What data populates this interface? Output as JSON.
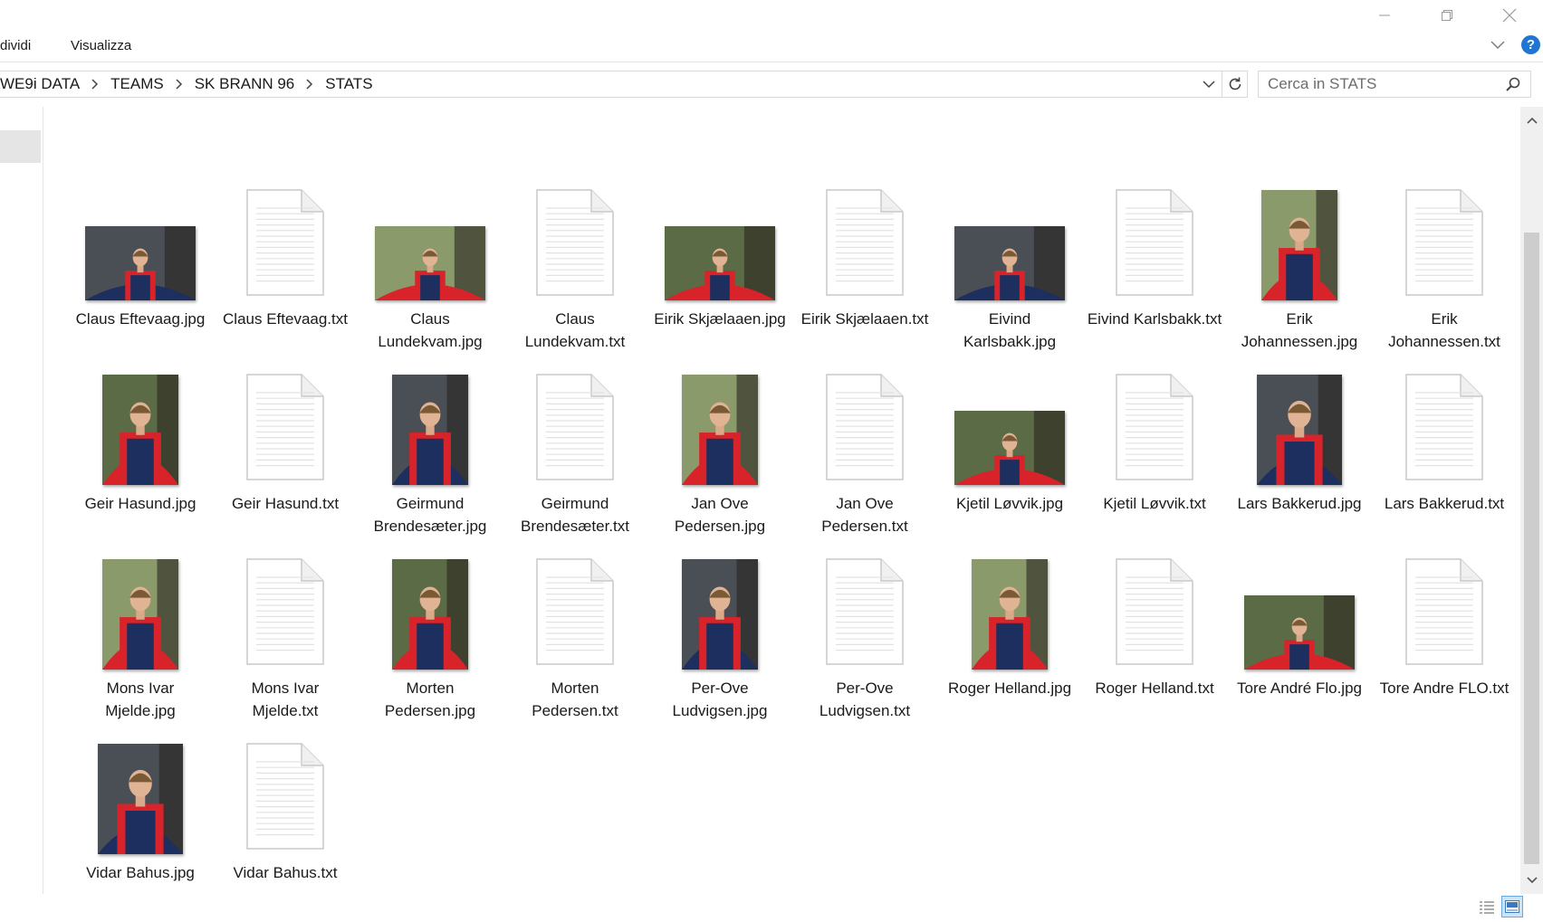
{
  "window": {
    "minimize_icon": "minimize-icon",
    "maximize_icon": "restore-icon",
    "close_icon": "close-icon"
  },
  "ribbon": {
    "tabs": [
      {
        "label": "dividi"
      },
      {
        "label": "Visualizza"
      }
    ],
    "help_label": "?"
  },
  "address": {
    "crumbs": [
      "WE9i DATA",
      "TEAMS",
      "SK BRANN 96",
      "STATS"
    ]
  },
  "search": {
    "placeholder": "Cerca in STATS"
  },
  "colors": {
    "accent": "#1f75d3",
    "kit_red": "#d8232a",
    "kit_navy": "#1d2f5e"
  },
  "files": [
    {
      "label": "Claus Eftevaag.jpg",
      "type": "photo",
      "orient": "landscape"
    },
    {
      "label": "Claus Eftevaag.txt",
      "type": "txt"
    },
    {
      "label": "Claus Lundekvam.jpg",
      "type": "photo",
      "orient": "landscape"
    },
    {
      "label": "Claus Lundekvam.txt",
      "type": "txt"
    },
    {
      "label": "Eirik Skjælaaen.jpg",
      "type": "photo",
      "orient": "landscape"
    },
    {
      "label": "Eirik Skjælaaen.txt",
      "type": "txt"
    },
    {
      "label": "Eivind Karlsbakk.jpg",
      "type": "photo",
      "orient": "landscape"
    },
    {
      "label": "Eivind Karlsbakk.txt",
      "type": "txt"
    },
    {
      "label": "Erik Johannessen.jpg",
      "type": "photo",
      "orient": "portrait"
    },
    {
      "label": "Erik Johannessen.txt",
      "type": "txt"
    },
    {
      "label": "Geir Hasund.jpg",
      "type": "photo",
      "orient": "portrait"
    },
    {
      "label": "Geir Hasund.txt",
      "type": "txt"
    },
    {
      "label": "Geirmund Brendesæter.jpg",
      "type": "photo",
      "orient": "portrait"
    },
    {
      "label": "Geirmund Brendesæter.txt",
      "type": "txt"
    },
    {
      "label": "Jan Ove Pedersen.jpg",
      "type": "photo",
      "orient": "portrait"
    },
    {
      "label": "Jan Ove Pedersen.txt",
      "type": "txt"
    },
    {
      "label": "Kjetil Løvvik.jpg",
      "type": "photo",
      "orient": "landscape"
    },
    {
      "label": "Kjetil Løvvik.txt",
      "type": "txt"
    },
    {
      "label": "Lars Bakkerud.jpg",
      "type": "photo",
      "orient": "portrait-wide"
    },
    {
      "label": "Lars Bakkerud.txt",
      "type": "txt"
    },
    {
      "label": "Mons Ivar Mjelde.jpg",
      "type": "photo",
      "orient": "portrait"
    },
    {
      "label": "Mons Ivar Mjelde.txt",
      "type": "txt"
    },
    {
      "label": "Morten Pedersen.jpg",
      "type": "photo",
      "orient": "portrait"
    },
    {
      "label": "Morten Pedersen.txt",
      "type": "txt"
    },
    {
      "label": "Per-Ove Ludvigsen.jpg",
      "type": "photo",
      "orient": "portrait"
    },
    {
      "label": "Per-Ove Ludvigsen.txt",
      "type": "txt"
    },
    {
      "label": "Roger Helland.jpg",
      "type": "photo",
      "orient": "portrait"
    },
    {
      "label": "Roger Helland.txt",
      "type": "txt"
    },
    {
      "label": "Tore André Flo.jpg",
      "type": "photo",
      "orient": "landscape"
    },
    {
      "label": "Tore Andre FLO.txt",
      "type": "txt"
    },
    {
      "label": "Vidar Bahus.jpg",
      "type": "photo",
      "orient": "portrait-wide"
    },
    {
      "label": "Vidar Bahus.txt",
      "type": "txt"
    }
  ],
  "view": {
    "details_icon": "details-view-icon",
    "thumbnails_icon": "large-icons-view-icon"
  }
}
